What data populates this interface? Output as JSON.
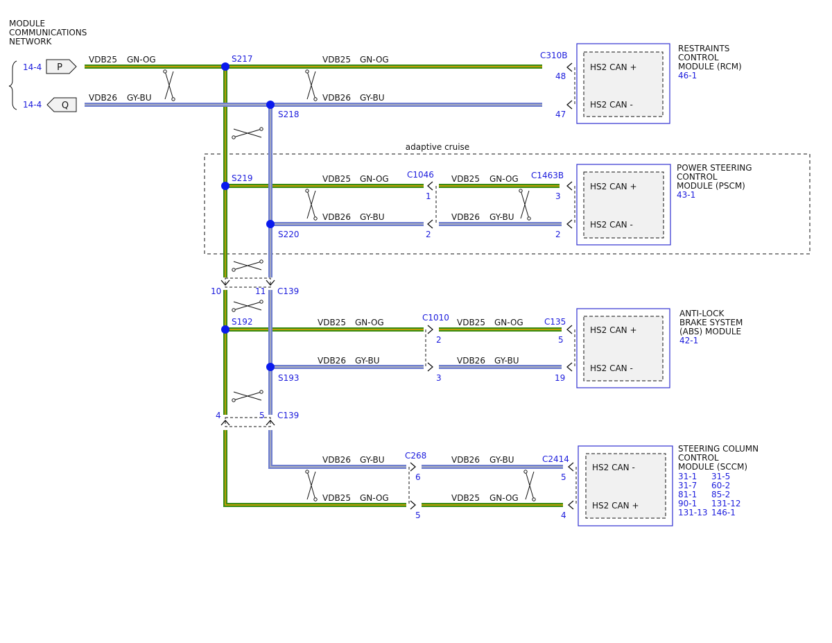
{
  "network": {
    "title_lines": [
      "MODULE",
      "COMMUNICATIONS",
      "NETWORK"
    ]
  },
  "connectors": {
    "p": {
      "ref": "14-4",
      "letter": "P"
    },
    "q": {
      "ref": "14-4",
      "letter": "Q"
    }
  },
  "wires": {
    "plus_circuit": "VDB25",
    "plus_color": "GN-OG",
    "minus_circuit": "VDB26",
    "minus_color": "GY-BU"
  },
  "splices": {
    "s217": "S217",
    "s218": "S218",
    "s219": "S219",
    "s220": "S220",
    "s192": "S192",
    "s193": "S193"
  },
  "region_label": "adaptive cruise",
  "inline_connectors": {
    "c1046": "C1046",
    "c1046_pin_plus": "1",
    "c1046_pin_minus": "2",
    "c139_upper": "C139",
    "c139_upper_pin_plus": "10",
    "c139_upper_pin_minus": "11",
    "c1010": "C1010",
    "c1010_pin_plus": "2",
    "c1010_pin_minus": "3",
    "c139_lower": "C139",
    "c139_lower_pin_plus": "4",
    "c139_lower_pin_minus": "5",
    "c268": "C268",
    "c268_pin_minus": "6",
    "c268_pin_plus": "5"
  },
  "modules": {
    "rcm": {
      "connector": "C310B",
      "pin_plus": "48",
      "pin_minus": "47",
      "name_lines": [
        "RESTRAINTS",
        "CONTROL",
        "MODULE (RCM)"
      ],
      "refs": [
        "46-1"
      ],
      "pin_plus_label": "HS2 CAN +",
      "pin_minus_label": "HS2 CAN -"
    },
    "pscm": {
      "connector": "C1463B",
      "pin_plus": "3",
      "pin_minus": "2",
      "name_lines": [
        "POWER STEERING",
        "CONTROL",
        "MODULE (PSCM)"
      ],
      "refs": [
        "43-1"
      ],
      "pin_plus_label": "HS2 CAN +",
      "pin_minus_label": "HS2 CAN -"
    },
    "abs": {
      "connector": "C135",
      "pin_plus": "5",
      "pin_minus": "19",
      "name_lines": [
        "ANTI-LOCK",
        "BRAKE SYSTEM",
        "(ABS) MODULE"
      ],
      "refs": [
        "42-1"
      ],
      "pin_plus_label": "HS2 CAN +",
      "pin_minus_label": "HS2 CAN -"
    },
    "sccm": {
      "connector": "C2414",
      "pin_minus": "5",
      "pin_plus": "4",
      "name_lines": [
        "STEERING COLUMN",
        "CONTROL",
        "MODULE (SCCM)"
      ],
      "refs": [
        "31-1",
        "31-5",
        "31-7",
        "60-2",
        "81-1",
        "85-2",
        "90-1",
        "131-12",
        "131-13",
        "146-1"
      ],
      "pin_minus_label": "HS2 CAN -",
      "pin_plus_label": "HS2 CAN +"
    }
  },
  "colors": {
    "green_wire": "#3a8c14",
    "green_stripe": "#e6a400",
    "blue_wire": "#6f7fd0",
    "blue_stripe": "#b8b8b8",
    "ref_blue": "#1a1adc",
    "splice_dot": "#0a1aee",
    "module_border": "#3030d0"
  },
  "icons": {
    "splice": "splice-dot-icon",
    "pin_arrow": "pin-arrow-icon",
    "twist": "twisted-pair-icon",
    "brace": "brace-icon"
  }
}
